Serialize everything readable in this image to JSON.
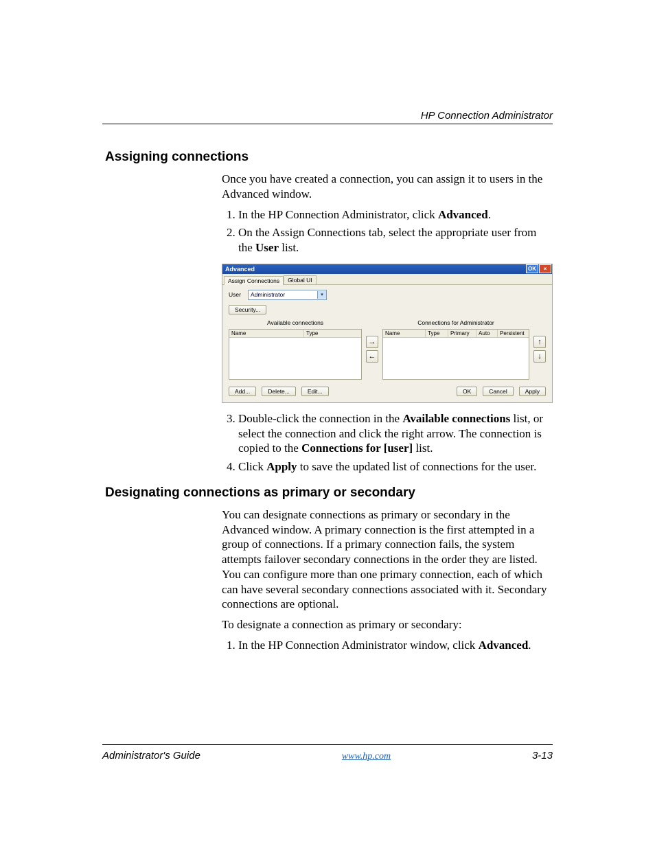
{
  "header": {
    "right": "HP Connection Administrator"
  },
  "section1": {
    "heading": "Assigning connections",
    "intro": "Once you have created a connection, you can assign it to users in the Advanced window.",
    "steps12": [
      {
        "pre": "In the HP Connection Administrator, click ",
        "bold": "Advanced",
        "post": "."
      },
      {
        "pre": "On the Assign Connections tab, select the appropriate user from the ",
        "bold": "User",
        "post": " list."
      }
    ],
    "steps34": [
      {
        "pre": "Double-click the connection in the ",
        "b1": "Available connections",
        "mid1": " list, or select the connection and click the right arrow. The connection is copied to the ",
        "b2": "Connections for [user]",
        "post": " list."
      },
      {
        "pre": "Click ",
        "b1": "Apply",
        "mid1": " to save the updated list of connections for the user.",
        "b2": "",
        "post": ""
      }
    ]
  },
  "dialog": {
    "title": "Advanced",
    "okBtn": "OK",
    "closeBtn": "×",
    "tabs": {
      "active": "Assign Connections",
      "other": "Global UI"
    },
    "userLabel": "User",
    "userValue": "Administrator",
    "securityBtn": "Security...",
    "leftTitle": "Available connections",
    "rightTitle": "Connections for Administrator",
    "leftCols": [
      "Name",
      "Type"
    ],
    "rightCols": [
      "Name",
      "Type",
      "Primary",
      "Auto",
      "Persistent"
    ],
    "arrows": {
      "right": "→",
      "left": "←",
      "up": "↑",
      "down": "↓"
    },
    "bottomLeft": [
      "Add...",
      "Delete...",
      "Edit..."
    ],
    "bottomRight": [
      "OK",
      "Cancel",
      "Apply"
    ]
  },
  "section2": {
    "heading": "Designating connections as primary or secondary",
    "para": "You can designate connections as primary or secondary in the Advanced window. A primary connection is the first attempted in a group of connections. If a primary connection fails, the system attempts failover secondary connections in the order they are listed. You can configure more than one primary connection, each of which can have several secondary connections associated with it. Secondary connections are optional.",
    "lead": "To designate a connection as primary or secondary:",
    "step1": {
      "pre": "In the HP Connection Administrator window, click ",
      "bold": "Advanced",
      "post": "."
    }
  },
  "footer": {
    "left": "Administrator's Guide",
    "center": "www.hp.com",
    "right": "3-13"
  }
}
